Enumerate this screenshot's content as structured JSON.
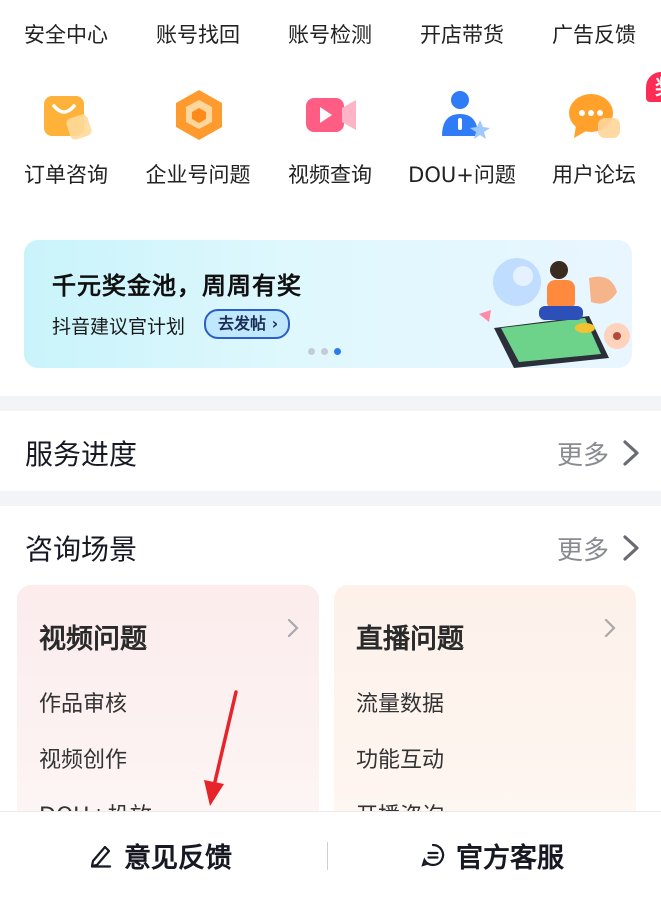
{
  "top_row": [
    {
      "label": "安全中心"
    },
    {
      "label": "账号找回"
    },
    {
      "label": "账号检测"
    },
    {
      "label": "开店带货"
    },
    {
      "label": "广告反馈"
    }
  ],
  "second_row": [
    {
      "label": "订单咨询",
      "icon": "shopping-bag-icon"
    },
    {
      "label": "企业号问题",
      "icon": "enterprise-cube-icon"
    },
    {
      "label": "视频查询",
      "icon": "video-play-icon"
    },
    {
      "label": "DOU+问题",
      "icon": "dou-plus-person-icon"
    },
    {
      "label": "用户论坛",
      "icon": "chat-bubble-icon",
      "badge": "奖"
    }
  ],
  "banner": {
    "title": "千元奖金池，周周有奖",
    "subtitle": "抖音建议官计划",
    "button": "去发帖",
    "slide_count": 3,
    "active_slide": 3
  },
  "service_progress": {
    "title": "服务进度",
    "more": "更多"
  },
  "consult": {
    "title": "咨询场景",
    "more": "更多",
    "cards": [
      {
        "title": "视频问题",
        "items": [
          "作品审核",
          "视频创作",
          "DOU+投放"
        ]
      },
      {
        "title": "直播问题",
        "items": [
          "流量数据",
          "功能互动",
          "开播咨询"
        ]
      }
    ]
  },
  "bottom_bar": {
    "feedback": "意见反馈",
    "service": "官方客服"
  },
  "colors": {
    "accent_red": "#fe2c55",
    "divider": "#f3f4f6",
    "muted_text": "#8a8b91",
    "active_dot": "#2b7bf0"
  }
}
